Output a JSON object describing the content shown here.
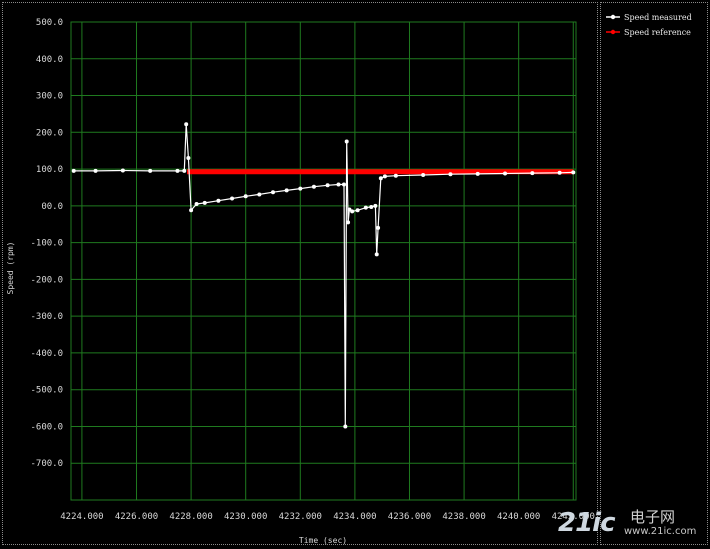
{
  "chart_data": {
    "type": "line",
    "title": "",
    "xlabel": "Time (sec)",
    "ylabel": "Speed (rpm)",
    "xlim": [
      4223.6,
      4242.1
    ],
    "ylim": [
      -800,
      500
    ],
    "x_ticks": [
      4224,
      4226,
      4228,
      4230,
      4232,
      4234,
      4236,
      4238,
      4240,
      4242
    ],
    "x_tick_labels": [
      "4224.000",
      "4226.000",
      "4228.000",
      "4230.000",
      "4232.000",
      "4234.000",
      "4236.000",
      "4238.000",
      "4240.000",
      "4242.000"
    ],
    "y_ticks": [
      500,
      400,
      300,
      200,
      100,
      0,
      -100,
      -200,
      -300,
      -400,
      -500,
      -600,
      -700
    ],
    "y_tick_labels": [
      "500.0",
      "400.0",
      "300.0",
      "200.0",
      "100.0",
      "00.0",
      "-100.0",
      "-200.0",
      "-300.0",
      "-400.0",
      "-500.0",
      "-600.0",
      "-700.0"
    ],
    "grid": true,
    "legend_position": "right",
    "series": [
      {
        "name": "Speed measured",
        "color": "#ffffff",
        "x": [
          4223.7,
          4224.5,
          4225.5,
          4226.5,
          4227.5,
          4227.75,
          4227.82,
          4227.9,
          4228.0,
          4228.2,
          4228.5,
          4229.0,
          4229.5,
          4230.0,
          4230.5,
          4231.0,
          4231.5,
          4232.0,
          4232.5,
          4233.0,
          4233.4,
          4233.6,
          4233.65,
          4233.7,
          4233.75,
          4233.8,
          4233.9,
          4234.1,
          4234.4,
          4234.6,
          4234.75,
          4234.8,
          4234.85,
          4234.95,
          4235.1,
          4235.5,
          4236.5,
          4237.5,
          4238.5,
          4239.5,
          4240.5,
          4241.5,
          4242.0
        ],
        "y": [
          95,
          95,
          96,
          95,
          95,
          95,
          222,
          130,
          -12,
          5,
          8,
          14,
          20,
          26,
          31,
          37,
          42,
          47,
          52,
          56,
          58,
          58,
          -600,
          175,
          -45,
          -10,
          -15,
          -12,
          -5,
          -3,
          0,
          -132,
          -60,
          75,
          80,
          82,
          84,
          86,
          87,
          88,
          89,
          90,
          91
        ]
      },
      {
        "name": "Speed reference",
        "color": "#ff0000",
        "x": [
          4227.85,
          4242.0
        ],
        "y": [
          93,
          93
        ]
      }
    ]
  },
  "watermark": {
    "brand": "21ic",
    "cn": "电子网",
    "url": "www.21ic.com"
  }
}
